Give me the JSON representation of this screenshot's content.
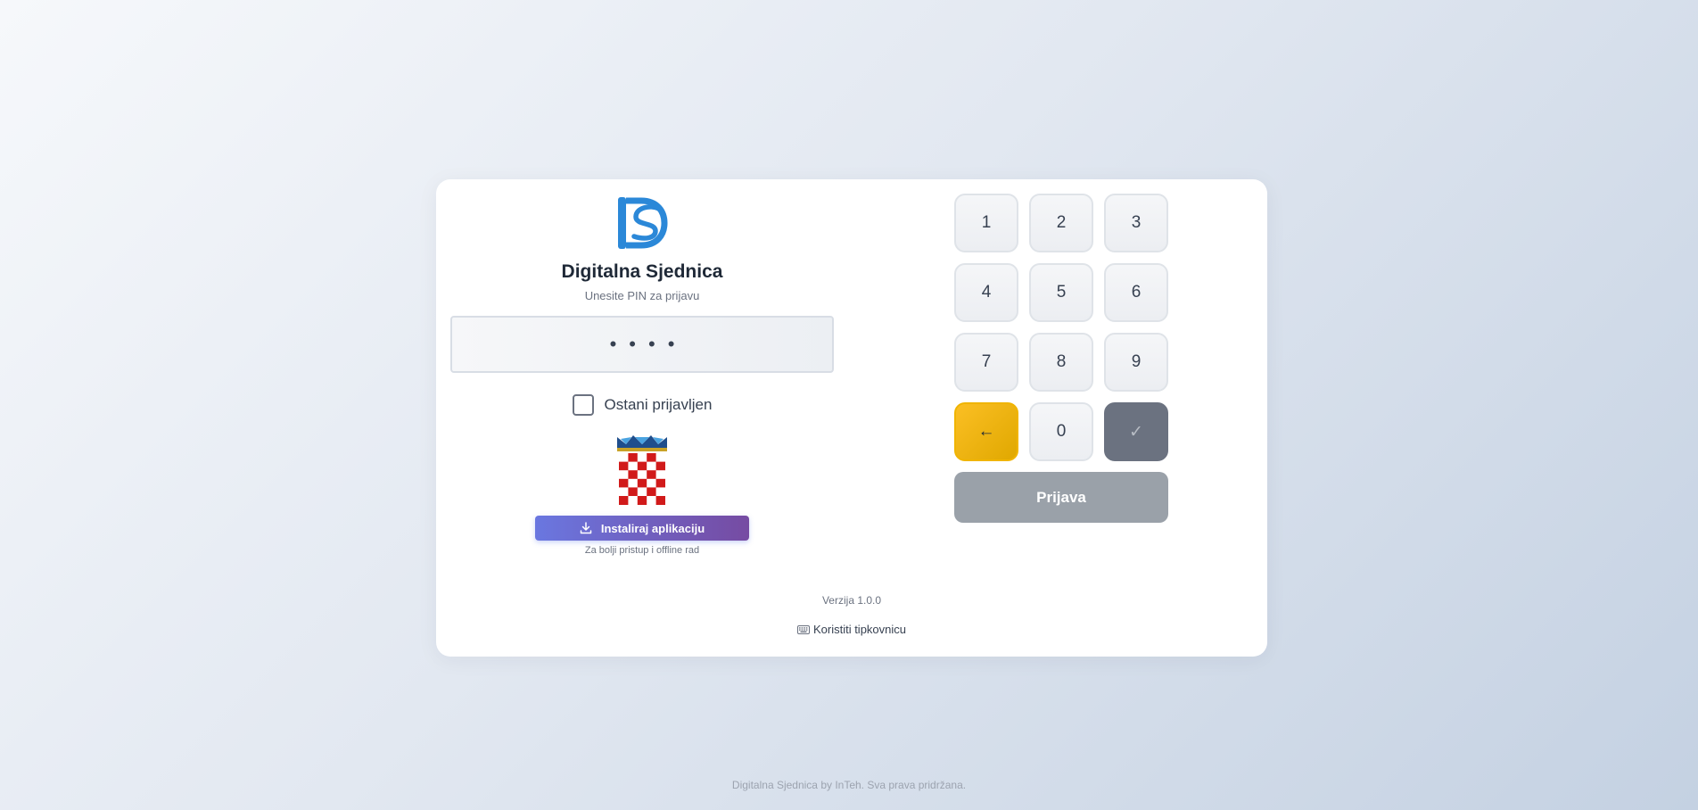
{
  "app": {
    "title": "Digitalna Sjednica",
    "subtitle": "Unesite PIN za prijavu"
  },
  "pin": {
    "masked_value": "••••"
  },
  "remember": {
    "label": "Ostani prijavljen",
    "checked": false
  },
  "install": {
    "button_label": "Instaliraj aplikaciju",
    "note": "Za bolji pristup i offline rad"
  },
  "keypad": {
    "keys": [
      "1",
      "2",
      "3",
      "4",
      "5",
      "6",
      "7",
      "8",
      "9"
    ],
    "zero": "0",
    "backspace_symbol": "←",
    "confirm_symbol": "✓",
    "login_label": "Prijava"
  },
  "meta": {
    "version": "Verzija 1.0.0",
    "keyboard_link": "Koristiti tipkovnicu"
  },
  "footer": {
    "text": "Digitalna Sjednica by InTeh. Sva prava pridržana."
  },
  "colors": {
    "brand_blue": "#2b88d8",
    "install_gradient_start": "#6a77e0",
    "install_gradient_end": "#764ba2",
    "backspace_yellow": "#fbbf24",
    "confirm_gray": "#6b7280",
    "login_gray": "#9aa1a9"
  },
  "icons": {
    "logo": "ds-logo",
    "coat_of_arms": "croatian-coat-of-arms",
    "install": "download-icon",
    "keyboard": "keyboard-icon"
  }
}
